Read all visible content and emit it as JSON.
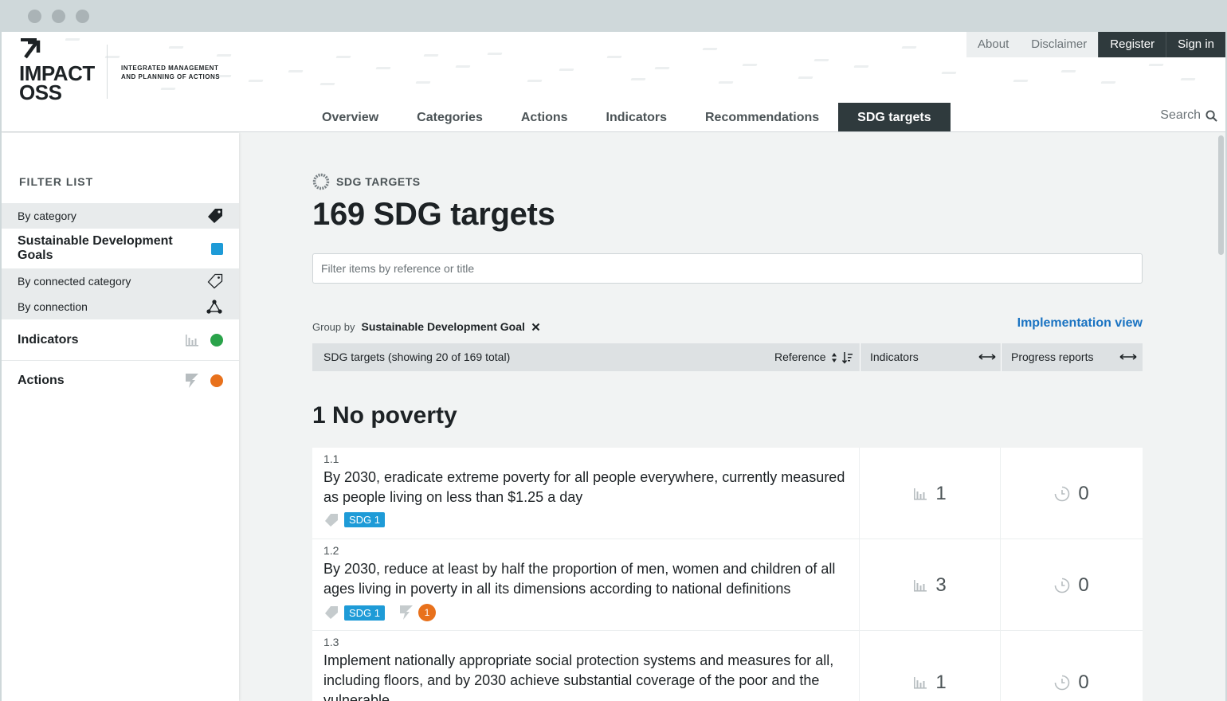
{
  "header": {
    "logo_line1": "IMPACT",
    "logo_line2": "OSS",
    "tagline_line1": "Integrated management",
    "tagline_line2": "and planning of actions"
  },
  "topnav": {
    "about": "About",
    "disclaimer": "Disclaimer",
    "register": "Register",
    "signin": "Sign in"
  },
  "mainnav": {
    "items": [
      "Overview",
      "Categories",
      "Actions",
      "Indicators",
      "Recommendations",
      "SDG targets"
    ],
    "active": "SDG targets",
    "search": "Search"
  },
  "sidebar": {
    "title": "FILTER LIST",
    "by_category": "By category",
    "sdgs": "Sustainable Development Goals",
    "by_connected_category": "By connected category",
    "by_connection": "By connection",
    "indicators": "Indicators",
    "actions": "Actions"
  },
  "page": {
    "kicker": "SDG TARGETS",
    "title": "169 SDG targets",
    "filter_placeholder": "Filter items by reference or title",
    "group_by_label": "Group by",
    "group_by_value": "Sustainable Development Goal",
    "implementation_view": "Implementation view"
  },
  "table": {
    "col_main": "SDG targets (showing 20 of 169 total)",
    "col_reference": "Reference",
    "col_indicators": "Indicators",
    "col_progress": "Progress reports"
  },
  "group_title": "1 No poverty",
  "rows": [
    {
      "ref": "1.1",
      "title": "By 2030, eradicate extreme poverty for all people everywhere, currently measured as people living on less than $1.25 a day",
      "tag": "SDG 1",
      "indicators": "1",
      "progress": "0"
    },
    {
      "ref": "1.2",
      "title": "By 2030, reduce at least by half the proportion of men, women and children of all ages living in poverty in all its dimensions according to national definitions",
      "tag": "SDG 1",
      "actions_count": "1",
      "indicators": "3",
      "progress": "0"
    },
    {
      "ref": "1.3",
      "title": "Implement nationally appropriate social protection systems and measures for all, including floors, and by 2030 achieve substantial coverage of the poor and the vulnerable",
      "indicators": "1",
      "progress": "0"
    }
  ],
  "colors": {
    "sdg_blue": "#1e9bd7",
    "indicators_green": "#2aa34a",
    "actions_orange": "#e8711c",
    "dark_nav": "#2f3a3d",
    "link_blue": "#1a73c2"
  }
}
